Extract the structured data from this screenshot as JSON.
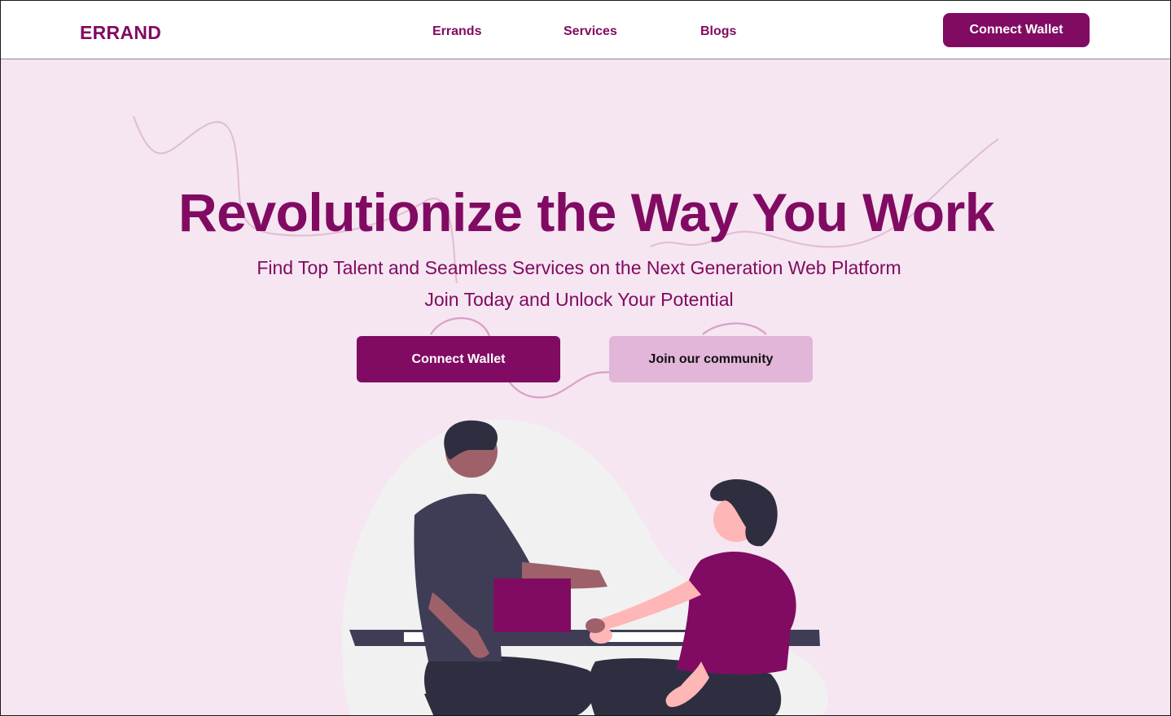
{
  "brand": {
    "name": "ERRAND",
    "primary": "#810b62",
    "secondary": "#e2b6d8",
    "background": "#f5e6f1"
  },
  "nav": {
    "links": [
      "Errands",
      "Services",
      "Blogs"
    ],
    "cta": "Connect Wallet"
  },
  "hero": {
    "headline": "Revolutionize the Way You Work",
    "subline_1": "Find Top Talent and Seamless Services on the Next Generation Web  Platform",
    "subline_2": "Join Today and Unlock Your Potential",
    "primary_cta": "Connect Wallet",
    "secondary_cta": "Join our community"
  },
  "illustration": {
    "subject": "two people shaking hands over a desk with a laptop"
  }
}
